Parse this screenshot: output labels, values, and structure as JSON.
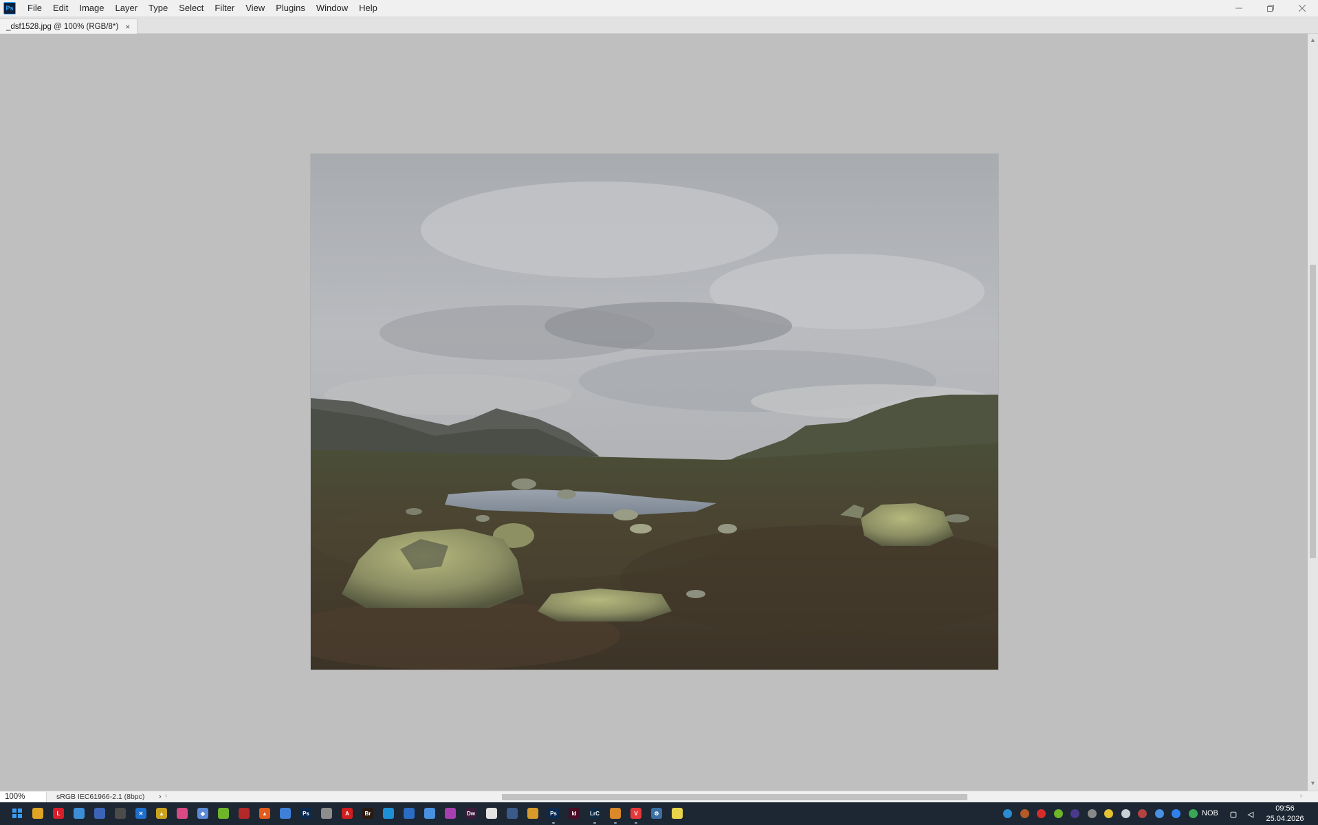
{
  "app": {
    "logo_text": "Ps",
    "name": "Adobe Photoshop"
  },
  "menu": [
    "File",
    "Edit",
    "Image",
    "Layer",
    "Type",
    "Select",
    "Filter",
    "View",
    "Plugins",
    "Window",
    "Help"
  ],
  "tab": {
    "title": "_dsf1528.jpg @ 100% (RGB/8*)",
    "close_glyph": "×"
  },
  "status": {
    "zoom": "100%",
    "profile": "sRGB IEC61966-2.1 (8bpc)",
    "arrow": "›"
  },
  "taskbar": {
    "apps": [
      {
        "name": "start",
        "label": "",
        "color": "#2a7bd5"
      },
      {
        "name": "file-explorer",
        "label": "",
        "color": "#e0a524"
      },
      {
        "name": "lr",
        "label": "L",
        "color": "#d81e2b"
      },
      {
        "name": "remote-desktop",
        "label": "",
        "color": "#3c8fd6"
      },
      {
        "name": "app-blue",
        "label": "",
        "color": "#3c64b8"
      },
      {
        "name": "obs",
        "label": "",
        "color": "#4b4b4b"
      },
      {
        "name": "app-x",
        "label": "✕",
        "color": "#1e6fcf"
      },
      {
        "name": "app-yellow",
        "label": "▲",
        "color": "#caa21d"
      },
      {
        "name": "app-photos",
        "label": "",
        "color": "#d74a84"
      },
      {
        "name": "app-diamond",
        "label": "◆",
        "color": "#5b8bd7"
      },
      {
        "name": "nvidia",
        "label": "",
        "color": "#6eb52a"
      },
      {
        "name": "app-red-circle",
        "label": "",
        "color": "#b32828"
      },
      {
        "name": "app-orange",
        "label": "▲",
        "color": "#e25a1c"
      },
      {
        "name": "app-chat",
        "label": "",
        "color": "#3e7fd8"
      },
      {
        "name": "photoshop",
        "label": "Ps",
        "color": "#0a2a52"
      },
      {
        "name": "app-pen",
        "label": "",
        "color": "#8d8d8d"
      },
      {
        "name": "acrobat",
        "label": "A",
        "color": "#d11d1d"
      },
      {
        "name": "bridge",
        "label": "Br",
        "color": "#2a1a10"
      },
      {
        "name": "edge",
        "label": "",
        "color": "#1d8fd6"
      },
      {
        "name": "app-doc",
        "label": "",
        "color": "#2b6cc4"
      },
      {
        "name": "app-page",
        "label": "",
        "color": "#4a90e2"
      },
      {
        "name": "app-purple",
        "label": "",
        "color": "#a83fb0"
      },
      {
        "name": "dreamweaver",
        "label": "Dw",
        "color": "#3b1a3a"
      },
      {
        "name": "app-chrome",
        "label": "",
        "color": "#e3e3e3"
      },
      {
        "name": "app-card",
        "label": "",
        "color": "#3a5a8a"
      },
      {
        "name": "app-folder",
        "label": "",
        "color": "#d79a2b"
      },
      {
        "name": "photoshop-2",
        "label": "Ps",
        "color": "#0a2a52"
      },
      {
        "name": "indesign",
        "label": "Id",
        "color": "#4a0b26"
      },
      {
        "name": "lightroom-classic",
        "label": "LrC",
        "color": "#0e2b46"
      },
      {
        "name": "app-bag",
        "label": "",
        "color": "#d9882a"
      },
      {
        "name": "vivaldi",
        "label": "V",
        "color": "#e5383b"
      },
      {
        "name": "settings",
        "label": "⚙",
        "color": "#3a6fa5"
      },
      {
        "name": "app-bulb",
        "label": "",
        "color": "#e9d34a"
      }
    ],
    "tray": [
      {
        "name": "tray-1",
        "color": "#2a8bd0"
      },
      {
        "name": "tray-2",
        "color": "#b35a27"
      },
      {
        "name": "tray-3",
        "color": "#d72c2c"
      },
      {
        "name": "tray-4",
        "color": "#6eb52a"
      },
      {
        "name": "tray-5",
        "color": "#4a3a8c"
      },
      {
        "name": "tray-6",
        "color": "#888888"
      },
      {
        "name": "tray-7",
        "color": "#e4c033"
      },
      {
        "name": "tray-8",
        "color": "#c9d0d8"
      },
      {
        "name": "tray-9",
        "color": "#b34242"
      },
      {
        "name": "tray-10",
        "color": "#4a90e2"
      },
      {
        "name": "tray-11",
        "color": "#2f80ed"
      },
      {
        "name": "tray-12",
        "color": "#3aa757"
      }
    ],
    "language": "NOB",
    "time": "09:56",
    "date": "25.04.2026"
  }
}
